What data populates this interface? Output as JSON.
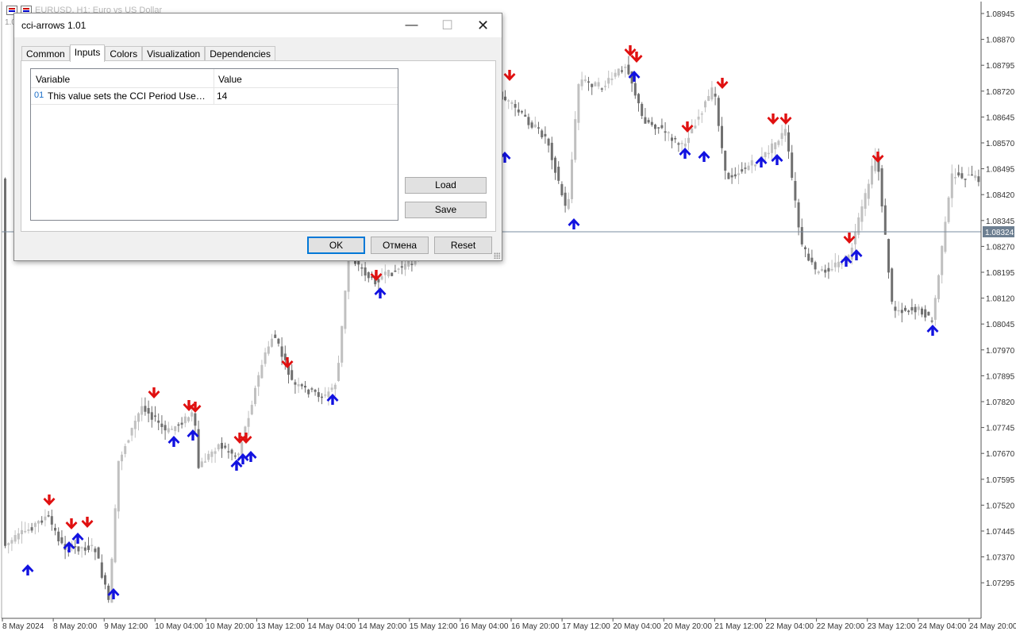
{
  "chart": {
    "title": "EURUSD, H1:  Euro vs US Dollar",
    "subtitle": "1.0",
    "current_price": "1.08324",
    "colors": {
      "bull": "#c0c0c0",
      "bear": "#707070",
      "up_arrow": "#1212e0",
      "down_arrow": "#e01010",
      "price_line": "#7a8da0",
      "price_tag": "#6d7f91"
    },
    "price_labels": [
      "1.08945",
      "1.08870",
      "1.08795",
      "1.08720",
      "1.08645",
      "1.08570",
      "1.08495",
      "1.08420",
      "1.08345",
      "1.08270",
      "1.08195",
      "1.08120",
      "1.08045",
      "1.07970",
      "1.07895",
      "1.07820",
      "1.07745",
      "1.07670",
      "1.07595",
      "1.07520",
      "1.07445",
      "1.07370",
      "1.07295"
    ],
    "time_labels": [
      "8 May 2024",
      "8 May 20:00",
      "9 May 12:00",
      "10 May 04:00",
      "10 May 20:00",
      "13 May 12:00",
      "14 May 04:00",
      "14 May 20:00",
      "15 May 12:00",
      "16 May 04:00",
      "16 May 20:00",
      "17 May 12:00",
      "20 May 04:00",
      "20 May 20:00",
      "21 May 12:00",
      "22 May 04:00",
      "22 May 20:00",
      "23 May 12:00",
      "24 May 04:00",
      "24 May 20:00"
    ]
  },
  "dialog": {
    "title": "cci-arrows 1.01",
    "tabs": [
      "Common",
      "Inputs",
      "Colors",
      "Visualization",
      "Dependencies"
    ],
    "active_tab": "Inputs",
    "columns": {
      "variable": "Variable",
      "value": "Value"
    },
    "rows": [
      {
        "num": "01",
        "variable": "This value sets the CCI Period Used, Th...",
        "value": "14"
      }
    ],
    "side_buttons": {
      "load": "Load",
      "save": "Save"
    },
    "buttons": {
      "ok": "OK",
      "cancel": "Отмена",
      "reset": "Reset"
    },
    "window_controls": [
      "minimize-icon",
      "maximize-icon",
      "close-icon"
    ]
  }
}
